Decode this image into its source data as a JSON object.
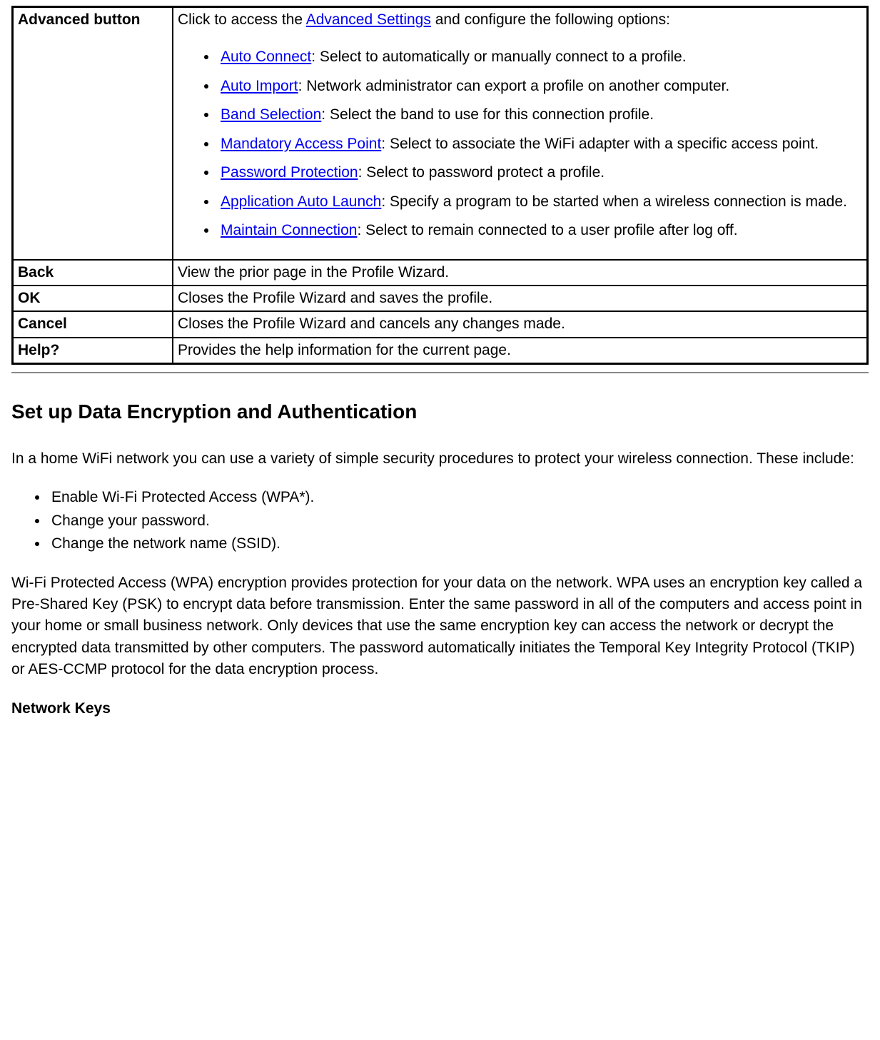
{
  "table": {
    "rows": [
      {
        "label": "Advanced button",
        "intro_pre": "Click to access the ",
        "intro_link": "Advanced Settings",
        "intro_post": " and configure the following options:",
        "options": [
          {
            "link": "Auto Connect",
            "desc": ": Select to automatically or manually connect to a profile."
          },
          {
            "link": "Auto Import",
            "desc": ": Network administrator can export a profile on another computer."
          },
          {
            "link": "Band Selection",
            "desc": ": Select the band to use for this connection profile."
          },
          {
            "link": "Mandatory Access Point",
            "desc": ": Select to associate the WiFi adapter with a specific access point."
          },
          {
            "link": "Password Protection",
            "desc": ": Select to password protect a profile."
          },
          {
            "link": "Application Auto Launch",
            "desc": ": Specify a program to be started when a wireless connection is made."
          },
          {
            "link": "Maintain Connection",
            "desc": ": Select to remain connected to a user profile after log off."
          }
        ]
      },
      {
        "label": "Back",
        "desc": "View the prior page in the Profile Wizard."
      },
      {
        "label": "OK",
        "desc": "Closes the Profile Wizard and saves the profile."
      },
      {
        "label": "Cancel",
        "desc": "Closes the Profile Wizard and cancels any changes made."
      },
      {
        "label": "Help?",
        "desc": "Provides the help information for the current page."
      }
    ]
  },
  "section": {
    "heading": "Set up Data Encryption and Authentication",
    "p1": "In a home WiFi network you can use a variety of simple security procedures to protect your wireless connection. These include:",
    "bullets": [
      "Enable Wi-Fi Protected Access (WPA*).",
      "Change your password.",
      "Change the network name (SSID)."
    ],
    "p2": "Wi-Fi Protected Access (WPA) encryption provides protection for your data on the network. WPA uses an encryption key called a Pre-Shared Key (PSK) to encrypt data before transmission. Enter the same password in all of the computers and access point in your home or small business network. Only devices that use the same encryption key can access the network or decrypt the encrypted data transmitted by other computers. The password automatically initiates the Temporal Key Integrity Protocol (TKIP) or AES-CCMP protocol for the data encryption process.",
    "subheading": "Network Keys"
  }
}
